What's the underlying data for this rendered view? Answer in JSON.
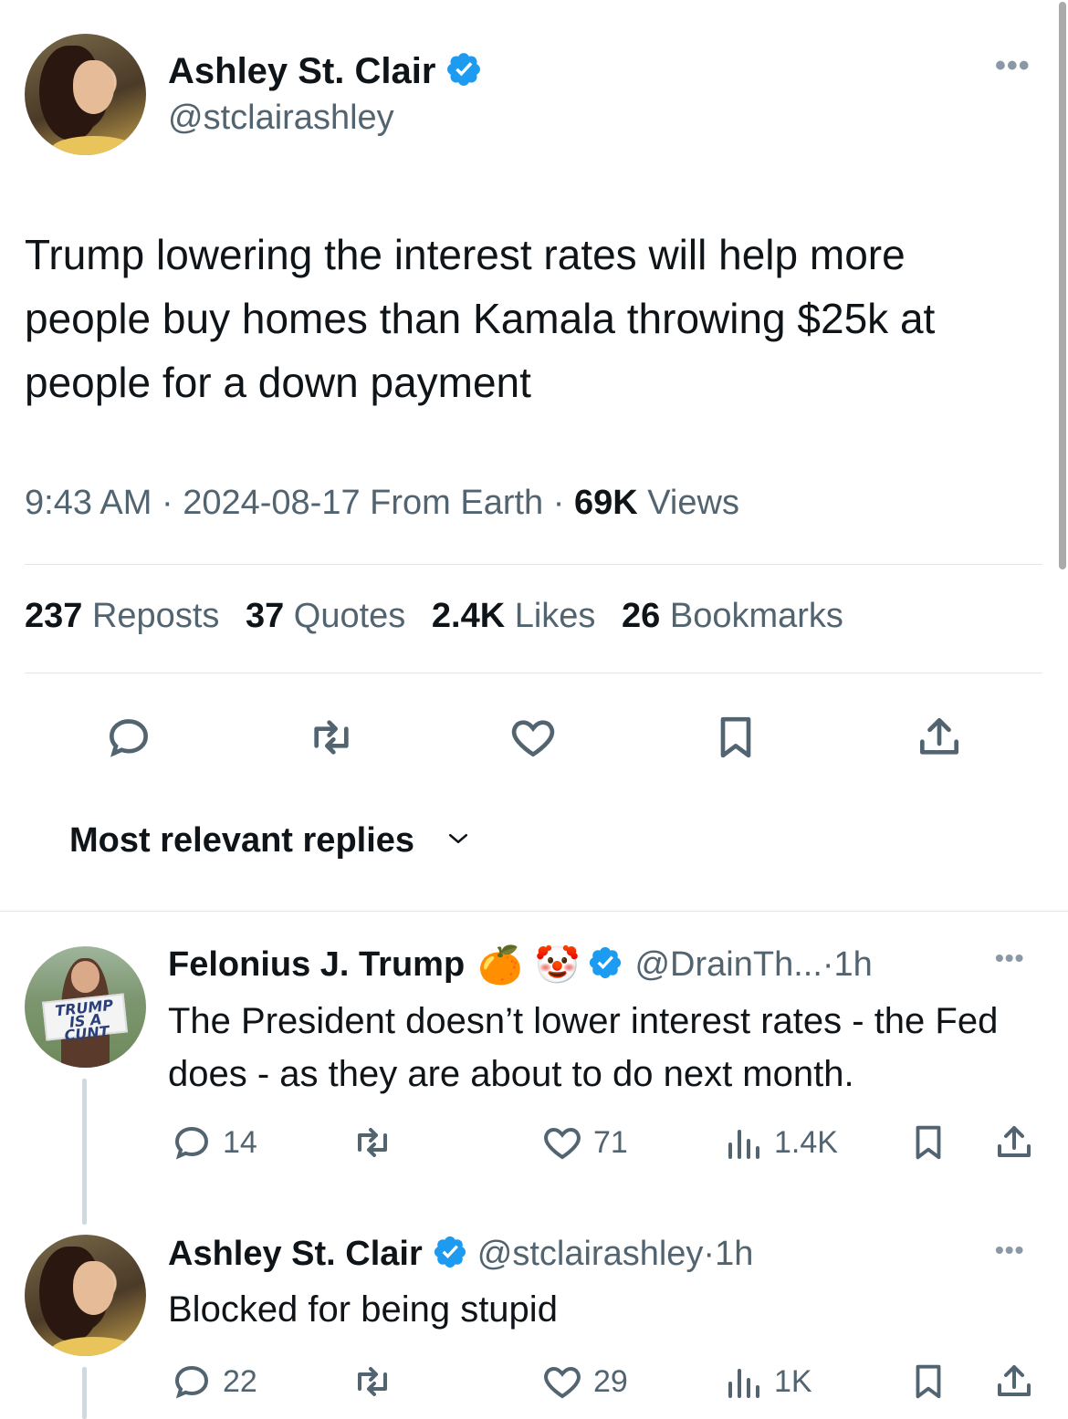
{
  "main_tweet": {
    "author_name": "Ashley St. Clair",
    "author_handle": "@stclairashley",
    "text": "Trump lowering the interest rates will help more people buy homes than Kamala throwing $25k at people for a down payment",
    "time": "9:43 AM",
    "date": "2024-08-17",
    "source": "From Earth",
    "views_count": "69K",
    "views_label": "Views",
    "stats": [
      {
        "count": "237",
        "label": "Reposts"
      },
      {
        "count": "37",
        "label": "Quotes"
      },
      {
        "count": "2.4K",
        "label": "Likes"
      },
      {
        "count": "26",
        "label": "Bookmarks"
      }
    ]
  },
  "replies_header": "Most relevant replies",
  "replies": [
    {
      "author_name": "Felonius J. Trump",
      "name_emojis": "🍊 🤡",
      "author_handle": "@DrainTh...",
      "age": "1h",
      "text": "The President doesn’t lower interest rates - the Fed does - as they are about to do next month.",
      "avatar_sign": "TRUMP IS A CUNT",
      "replies": "14",
      "likes": "71",
      "views": "1.4K"
    },
    {
      "author_name": "Ashley St. Clair",
      "author_handle": "@stclairashley",
      "age": "1h",
      "text": "Blocked for being stupid",
      "replies": "22",
      "likes": "29",
      "views": "1K"
    }
  ],
  "colors": {
    "text": "#0f1419",
    "muted": "#536471",
    "verified": "#1d9bf0",
    "divider": "#e1e6ea"
  }
}
